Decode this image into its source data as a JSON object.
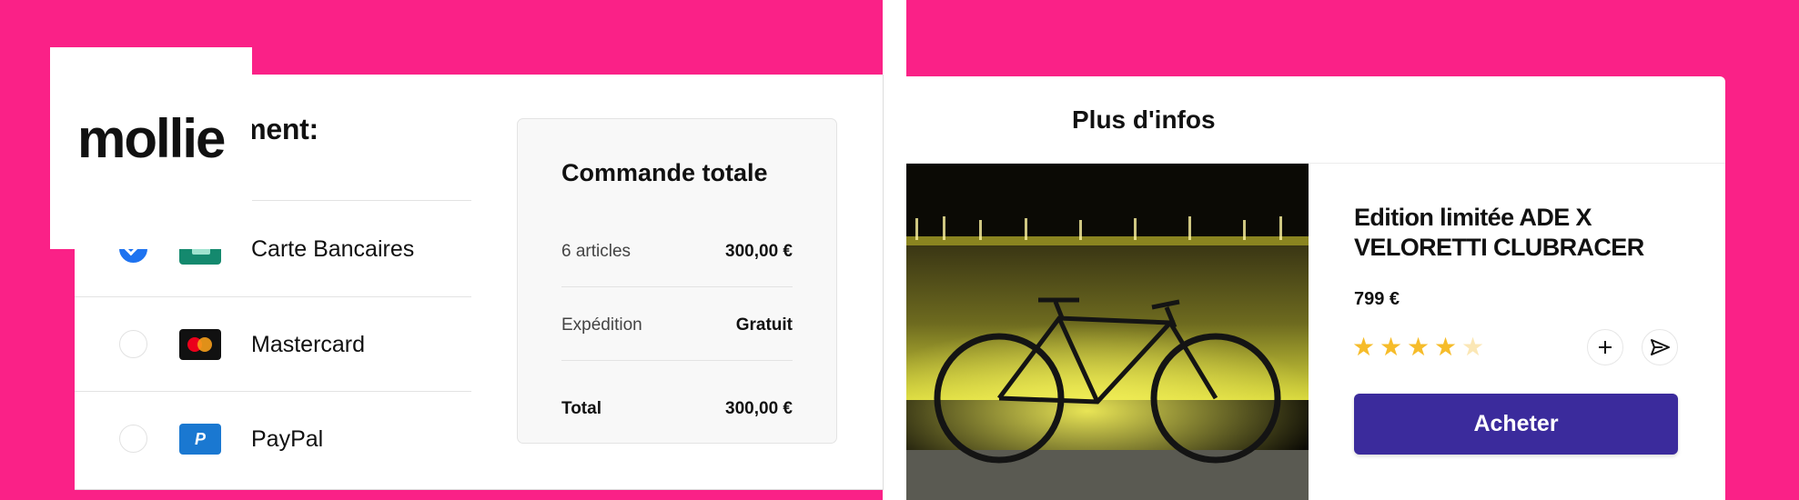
{
  "colors": {
    "background_pink": "#fa2187",
    "selected_radio": "#1e73f0",
    "buy_button": "#3b2b9c",
    "star_filled": "#f6bc2a",
    "star_empty": "#fbe7b5"
  },
  "checkout": {
    "logo": "mollie",
    "methods_title_visible": "s de paiement:",
    "methods": [
      {
        "label": "Carte Bancaires",
        "icon": "credit-card-icon",
        "selected": true
      },
      {
        "label": "Mastercard",
        "icon": "mastercard-icon",
        "selected": false
      },
      {
        "label": "PayPal",
        "icon": "paypal-icon",
        "selected": false
      }
    ],
    "order": {
      "title": "Commande totale",
      "rows": [
        {
          "label": "6 articles",
          "value": "300,00 €"
        },
        {
          "label": "Expédition",
          "value": "Gratuit"
        },
        {
          "label": "Total",
          "value": "300,00 €"
        }
      ]
    }
  },
  "product": {
    "header": "Plus d'infos",
    "title": "Edition limitée ADE X VELORETTI CLUBRACER",
    "price": "799 €",
    "rating": 4,
    "rating_max": 5,
    "icons": {
      "add": "plus-icon",
      "share": "send-icon",
      "image": "bicycle-photo"
    },
    "buy_label": "Acheter"
  }
}
